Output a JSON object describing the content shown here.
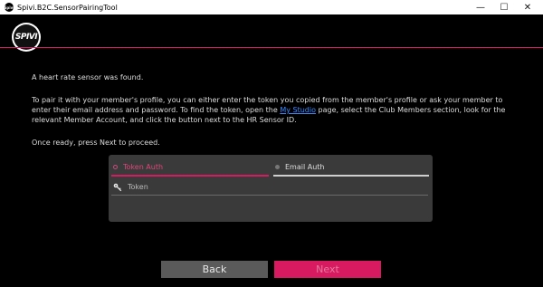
{
  "window": {
    "title": "Spivi.B2C.SensorPairingTool",
    "app_icon_text": "Spivi",
    "controls": {
      "minimize": "—",
      "maximize": "☐",
      "close": "✕"
    }
  },
  "header": {
    "logo_text": "SPIVI",
    "accent_color": "#d81b60"
  },
  "content": {
    "found_text": "A heart rate sensor was found.",
    "instructions_before_link": "To pair it with your member's profile, you can either enter the token you copied from the member's profile or ask your member to enter their email address and password. To find the token, open the ",
    "link_text": "My Studio",
    "instructions_after_link": " page, select the Club Members section, look for the relevant Member Account, and click the button next to the HR Sensor ID.",
    "proceed_text": "Once ready, press Next to proceed."
  },
  "auth": {
    "tabs": [
      {
        "label": "Token Auth",
        "selected": true
      },
      {
        "label": "Email Auth",
        "selected": false
      }
    ],
    "token_placeholder": "Token",
    "token_value": ""
  },
  "buttons": {
    "back": "Back",
    "next": "Next",
    "next_enabled": false
  }
}
